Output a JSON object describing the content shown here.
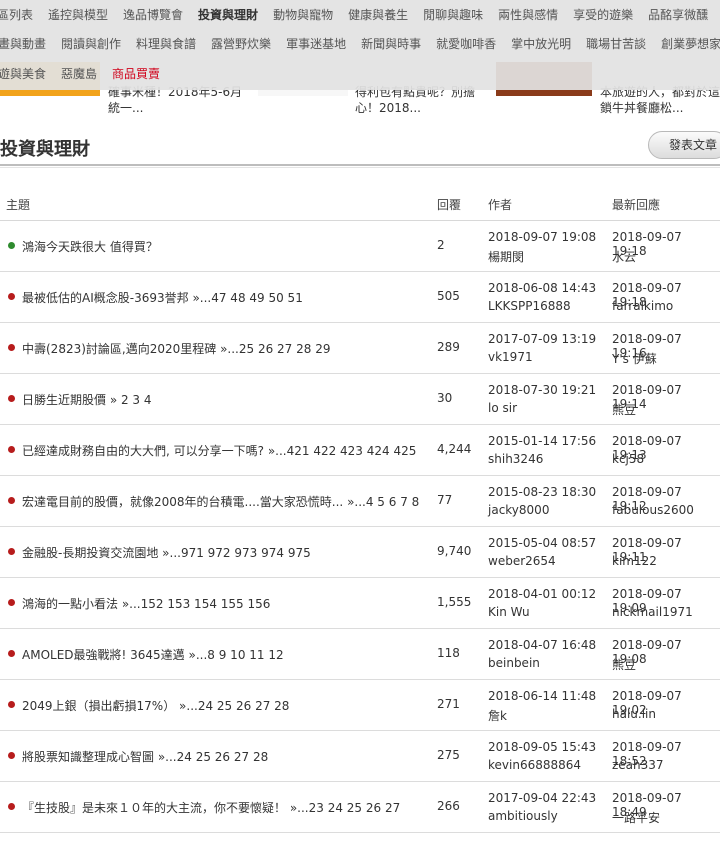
{
  "categories": {
    "row1": [
      {
        "label": "區列表"
      },
      {
        "label": "遙控與模型"
      },
      {
        "label": "逸品博覽會"
      },
      {
        "label": "投資與理財",
        "active": true
      },
      {
        "label": "動物與寵物"
      },
      {
        "label": "健康與養生"
      },
      {
        "label": "閒聊與趣味"
      },
      {
        "label": "兩性與感情"
      },
      {
        "label": "享受的遊樂"
      },
      {
        "label": "品酩享微醺"
      }
    ],
    "row2": [
      {
        "label": "畫與動畫"
      },
      {
        "label": "閱讀與創作"
      },
      {
        "label": "料理與食譜"
      },
      {
        "label": "露營野炊樂"
      },
      {
        "label": "軍事迷基地"
      },
      {
        "label": "新聞與時事"
      },
      {
        "label": "就愛咖啡香"
      },
      {
        "label": "掌中放光明"
      },
      {
        "label": "職場甘苦談"
      },
      {
        "label": "創業夢想家"
      }
    ],
    "row3": [
      {
        "label": "遊與美食"
      },
      {
        "label": "惡魔島"
      },
      {
        "label": "商品買賣",
        "hot": true
      }
    ]
  },
  "features": {
    "card1": "確事米種！2018年5-6月統一...",
    "card2": "得利包有點貴呢？別擔心！2018...",
    "card3": "本旅遊的人，都對於這鎖牛丼餐廳松..."
  },
  "section": {
    "title": "投資與理財",
    "post_button": "發表文章"
  },
  "table": {
    "headers": {
      "topic": "主題",
      "replies": "回覆",
      "author": "作者",
      "last_reply": "最新回應"
    },
    "rows": [
      {
        "new": true,
        "title": "鴻海今天跌很大 值得買？",
        "pages": "",
        "replies": "2",
        "author_date": "2018-09-07 19:08",
        "author": "楊期閔",
        "last_date": "2018-09-07 19:18",
        "last_user": "水云"
      },
      {
        "title": "最被低估的AI概念股-3693誉邦",
        "pages": " »...47 48 49 50 51",
        "replies": "505",
        "author_date": "2018-06-08 14:43",
        "author": "LKKSPP16888",
        "last_date": "2018-09-07 19:18",
        "last_user": "farralkimo"
      },
      {
        "title": "中壽(2823)討論區,邁向2020里程碑",
        "pages": " »...25 26 27 28 29",
        "replies": "289",
        "author_date": "2017-07-09 13:19",
        "author": "vk1971",
        "last_date": "2018-09-07 19:16",
        "last_user": "Y's 伊蘇"
      },
      {
        "title": "日勝生近期股價",
        "pages": " » 2 3 4",
        "replies": "30",
        "author_date": "2018-07-30 19:21",
        "author": "lo sir",
        "last_date": "2018-09-07 19:14",
        "last_user": "熊豆"
      },
      {
        "title": "已經達成財務自由的大大們, 可以分享一下嗎?",
        "pages": " »...421 422 423 424 425",
        "replies": "4,244",
        "author_date": "2015-01-14 17:56",
        "author": "shih3246",
        "last_date": "2018-09-07 19:13",
        "last_user": "kcj58"
      },
      {
        "title": "宏達電目前的股價，就像2008年的台積電....當大家恐慌時...",
        "pages": " »...4 5 6 7 8",
        "replies": "77",
        "author_date": "2015-08-23 18:30",
        "author": "jacky8000",
        "last_date": "2018-09-07 19:12",
        "last_user": "fabulous2600"
      },
      {
        "title": "金融股-長期投資交流園地",
        "pages": " »...971 972 973 974 975",
        "replies": "9,740",
        "author_date": "2015-05-04 08:57",
        "author": "weber2654",
        "last_date": "2018-09-07 19:11",
        "last_user": "kim122"
      },
      {
        "title": "鴻海的一點小看法",
        "pages": " »...152 153 154 155 156",
        "replies": "1,555",
        "author_date": "2018-04-01 00:12",
        "author": "Kin Wu",
        "last_date": "2018-09-07 19:09",
        "last_user": "nickmail1971"
      },
      {
        "title": "AMOLED最強戰將! 3645達邁",
        "pages": " »...8 9 10 11 12",
        "replies": "118",
        "author_date": "2018-04-07 16:48",
        "author": "beinbein",
        "last_date": "2018-09-07 19:08",
        "last_user": "熊豆"
      },
      {
        "title": "2049上銀（損出虧損17%）",
        "pages": " »...24 25 26 27 28",
        "replies": "271",
        "author_date": "2018-06-14 11:48",
        "author": "詹k",
        "last_date": "2018-09-07 19:02",
        "last_user": "halu.lin"
      },
      {
        "title": "將股票知識整理成心智圖",
        "pages": " »...24 25 26 27 28",
        "replies": "275",
        "author_date": "2018-09-05 15:43",
        "author": "kevin66888864",
        "last_date": "2018-09-07 18:52",
        "last_user": "zeah337"
      },
      {
        "title": "『生技股』是未來１０年的大主流，你不要懷疑！",
        "pages": " »...23 24 25 26 27",
        "replies": "266",
        "author_date": "2017-09-04 22:43",
        "author": "ambitiously",
        "last_date": "2018-09-07 18:49",
        "last_user": "一路平安"
      }
    ]
  },
  "colors": {
    "hot_link": "#d0021b",
    "bullet_old": "#b71c1c",
    "bullet_new": "#2e8b2e",
    "category_bar": "#e2e2e2"
  }
}
